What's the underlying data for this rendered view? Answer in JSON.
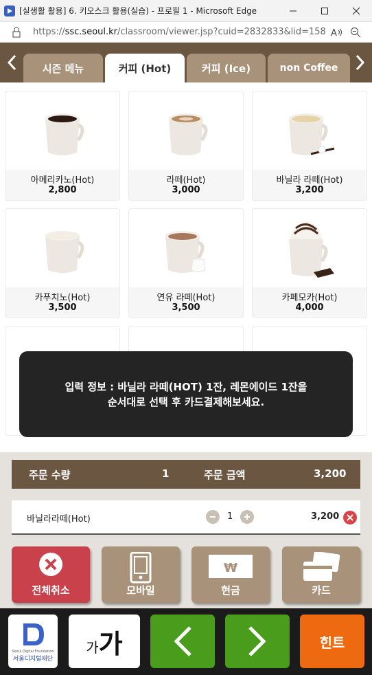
{
  "window": {
    "title": "[실생활 활용] 6. 키오스크 활용(실습) - 프로필 1 - Microsoft Edge",
    "url_prefix": "https://",
    "url_host": "ssc.seoul.kr",
    "url_path": "/classroom/viewer.jsp?cuid=2832833&lid=158..."
  },
  "tabs": [
    {
      "label": "시즌 메뉴",
      "active": false
    },
    {
      "label": "커피 (Hot)",
      "active": true
    },
    {
      "label": "커피 (Ice)",
      "active": false
    },
    {
      "label": "non Coffee",
      "active": false
    }
  ],
  "menu": [
    {
      "name": "아메리카노(Hot)",
      "price": "2,800",
      "image": "americano-cup"
    },
    {
      "name": "라떼(Hot)",
      "price": "3,000",
      "image": "latte-cup"
    },
    {
      "name": "바닐라 라떼(Hot)",
      "price": "3,200",
      "image": "vanilla-latte-cup"
    },
    {
      "name": "카푸치노(Hot)",
      "price": "3,500",
      "image": "cappuccino-cup"
    },
    {
      "name": "연유 라떼(Hot)",
      "price": "3,500",
      "image": "condensed-milk-latte-cup"
    },
    {
      "name": "카페모카(Hot)",
      "price": "4,000",
      "image": "cafe-mocha-cup"
    }
  ],
  "toast": {
    "line1": "입력 정보 : 바닐라 라떼(HOT) 1잔, 레몬에이드 1잔을",
    "line2": "순서대로 선택 후 카드결제해보세요."
  },
  "summary": {
    "qty_label": "주문 수량",
    "qty_value": "1",
    "amount_label": "주문 금액",
    "amount_value": "3,200"
  },
  "order": {
    "item_name": "바닐라라떼(Hot)",
    "qty": "1",
    "price": "3,200"
  },
  "actions": {
    "cancel_all": "전체취소",
    "mobile": "모바일",
    "cash": "현금",
    "card": "카드",
    "cash_symbol": "₩"
  },
  "bottom": {
    "logo_caption_en": "Seoul Digital Foundation",
    "logo_caption_ko": "서울디지털재단",
    "font_size_small": "가",
    "font_size_large": "가",
    "hint": "힌트"
  },
  "colors": {
    "brand_brown": "#6b5642",
    "tab_inactive": "#a8927a",
    "cancel_red": "#c9414b",
    "pay_tan": "#a8927a",
    "nav_green": "#4a9c1d",
    "hint_orange": "#ee6a10",
    "remove_red": "#d9434a"
  }
}
